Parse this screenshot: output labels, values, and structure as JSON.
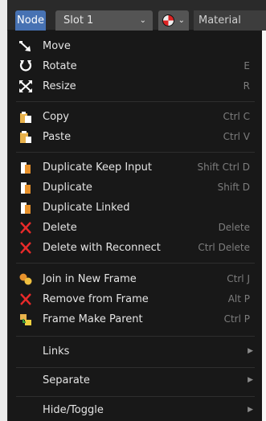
{
  "header": {
    "node_label": "Node",
    "slot_label": "Slot 1",
    "material_label": "Material"
  },
  "menu": {
    "move": {
      "label": "Move",
      "shortcut": ""
    },
    "rotate": {
      "label": "Rotate",
      "shortcut": "E"
    },
    "resize": {
      "label": "Resize",
      "shortcut": "R"
    },
    "copy": {
      "label": "Copy",
      "shortcut": "Ctrl C"
    },
    "paste": {
      "label": "Paste",
      "shortcut": "Ctrl V"
    },
    "duplicate_keep_input": {
      "label": "Duplicate Keep Input",
      "shortcut": "Shift Ctrl D"
    },
    "duplicate": {
      "label": "Duplicate",
      "shortcut": "Shift D"
    },
    "duplicate_linked": {
      "label": "Duplicate Linked",
      "shortcut": ""
    },
    "delete": {
      "label": "Delete",
      "shortcut": "Delete"
    },
    "delete_with_reconnect": {
      "label": "Delete with Reconnect",
      "shortcut": "Ctrl Delete"
    },
    "join_in_new_frame": {
      "label": "Join in New Frame",
      "shortcut": "Ctrl J"
    },
    "remove_from_frame": {
      "label": "Remove from Frame",
      "shortcut": "Alt P"
    },
    "frame_make_parent": {
      "label": "Frame Make Parent",
      "shortcut": "Ctrl P"
    },
    "links": {
      "label": "Links"
    },
    "separate": {
      "label": "Separate"
    },
    "hide_toggle": {
      "label": "Hide/Toggle"
    }
  }
}
